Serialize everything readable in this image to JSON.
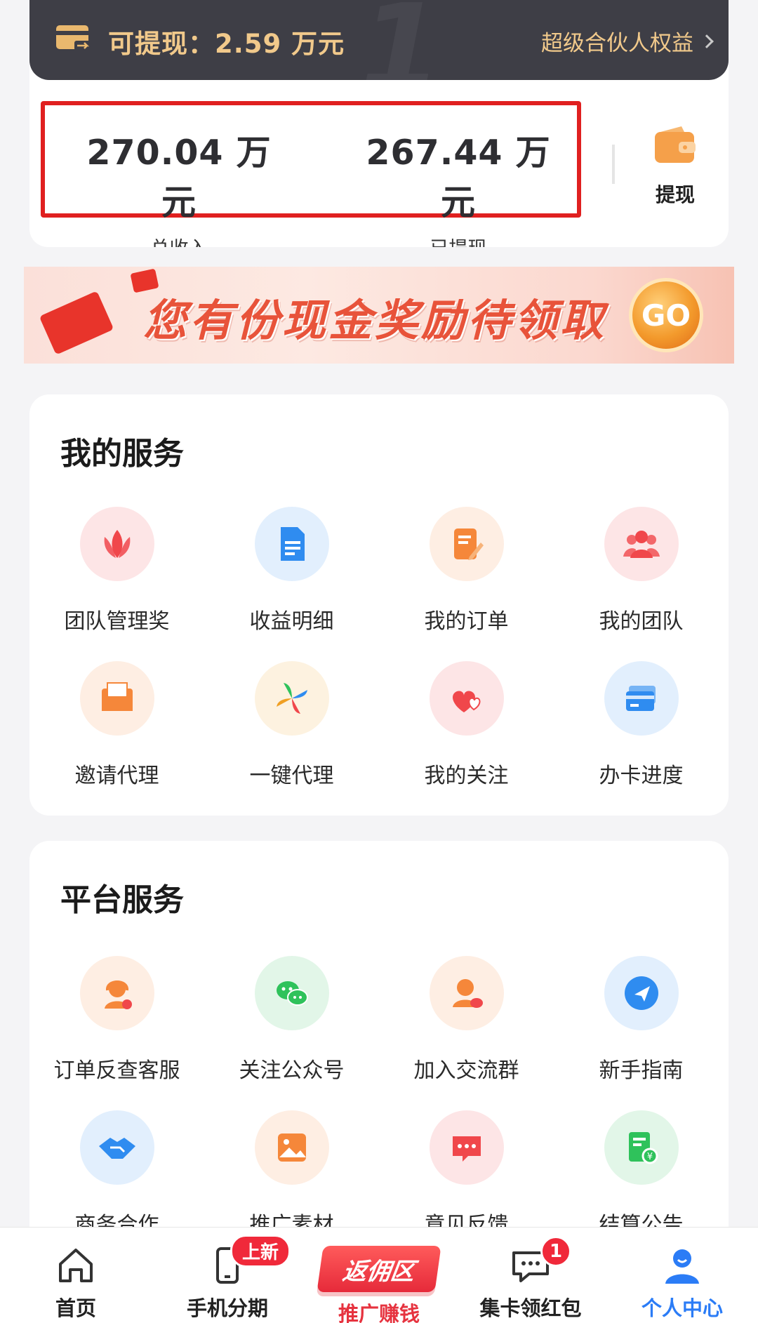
{
  "earnings": {
    "withdrawable_text": "可提现：2.59 万元",
    "partner_link": "超级合伙人权益",
    "total_income_value": "270.04 万元",
    "total_income_label": "总收入",
    "withdrawn_value": "267.44 万元",
    "withdrawn_label": "已提现",
    "withdraw_button": "提现"
  },
  "banner": {
    "text": "您有份现金奖励待领取",
    "go": "GO"
  },
  "my_services": {
    "title": "我的服务",
    "items": [
      {
        "label": "团队管理奖",
        "icon": "lotus-icon",
        "color": "#f0474b"
      },
      {
        "label": "收益明细",
        "icon": "document-icon",
        "color": "#2f8cf0"
      },
      {
        "label": "我的订单",
        "icon": "order-edit-icon",
        "color": "#f5873a"
      },
      {
        "label": "我的团队",
        "icon": "team-icon",
        "color": "#f0474b"
      },
      {
        "label": "邀请代理",
        "icon": "envelope-icon",
        "color": "#f5873a"
      },
      {
        "label": "一键代理",
        "icon": "pinwheel-icon",
        "color": "#f0a024"
      },
      {
        "label": "我的关注",
        "icon": "hearts-icon",
        "color": "#f0474b"
      },
      {
        "label": "办卡进度",
        "icon": "cards-icon",
        "color": "#2f8cf0"
      }
    ]
  },
  "platform_services": {
    "title": "平台服务",
    "items": [
      {
        "label": "订单反查客服",
        "icon": "customer-service-icon",
        "color": "#f5873a"
      },
      {
        "label": "关注公众号",
        "icon": "wechat-icon",
        "color": "#2fc25b"
      },
      {
        "label": "加入交流群",
        "icon": "group-chat-icon",
        "color": "#f5873a"
      },
      {
        "label": "新手指南",
        "icon": "navigation-icon",
        "color": "#2f8cf0"
      },
      {
        "label": "商务合作",
        "icon": "handshake-icon",
        "color": "#2f8cf0"
      },
      {
        "label": "推广素材",
        "icon": "image-icon",
        "color": "#f5873a"
      },
      {
        "label": "意见反馈",
        "icon": "feedback-icon",
        "color": "#f0474b"
      },
      {
        "label": "结算公告",
        "icon": "settlement-notice-icon",
        "color": "#2fc25b"
      }
    ]
  },
  "bottom_nav": {
    "home": "首页",
    "installment": "手机分期",
    "installment_badge": "上新",
    "promo": "返佣区",
    "promo_label": "推广赚钱",
    "cards": "集卡领红包",
    "cards_badge": "1",
    "profile": "个人中心"
  }
}
